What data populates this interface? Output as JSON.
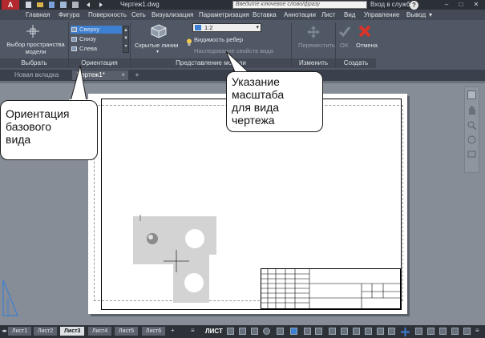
{
  "window": {
    "app_button": "A",
    "document_title": "Чертеж1.dwg",
    "search_placeholder": "Введите ключевое слово/фразу",
    "signin": "Вход в службы",
    "help": "?",
    "controls": [
      "–",
      "□",
      "✕"
    ]
  },
  "ribbon_tabs": [
    "Главная",
    "Фигура",
    "Поверхность",
    "Сеть",
    "Визуализация",
    "Параметризация",
    "Вставка",
    "Аннотации",
    "Лист",
    "Вид",
    "Управление",
    "Вывод"
  ],
  "active_ribbon_tab": "Главная",
  "panels": {
    "select": {
      "button": "Выбор пространства модели",
      "line1": "Выбор пространства",
      "line2": "модели",
      "title": "Выбрать"
    },
    "orientation": {
      "views": [
        "Сверху",
        "Снизу",
        "Слева"
      ],
      "selected": "Сверху",
      "title": "Ориентация"
    },
    "model_view": {
      "hidden_lines": "Скрытые линии",
      "scale": "1:2",
      "edge_visibility": "Видимость ребер",
      "tangent_visibility": "Наследование свойств вида",
      "title": "Представление модели"
    },
    "modify": {
      "move": "Переместить",
      "title": "Изменить"
    },
    "create": {
      "ok": "OK",
      "cancel": "Отмена",
      "title": "Создать"
    }
  },
  "doc_tabs": {
    "new_tab": "Новая вкладка",
    "drawing": "Чертеж1*",
    "add": "+"
  },
  "callouts": {
    "scale": [
      "Указание",
      "масштаба",
      "для вида",
      "чертежа"
    ],
    "orientation": [
      "Ориентация",
      "базового",
      "вида"
    ]
  },
  "layout_tabs": [
    "Лист1",
    "Лист2",
    "Лист3",
    "Лист4",
    "Лист5",
    "Лист6"
  ],
  "active_layout": "Лист3",
  "status": {
    "space": "ЛИСТ"
  },
  "colors": {
    "accent_blue": "#3d7fd1",
    "cancel_red": "#d9332b",
    "app_red": "#b3282d"
  }
}
